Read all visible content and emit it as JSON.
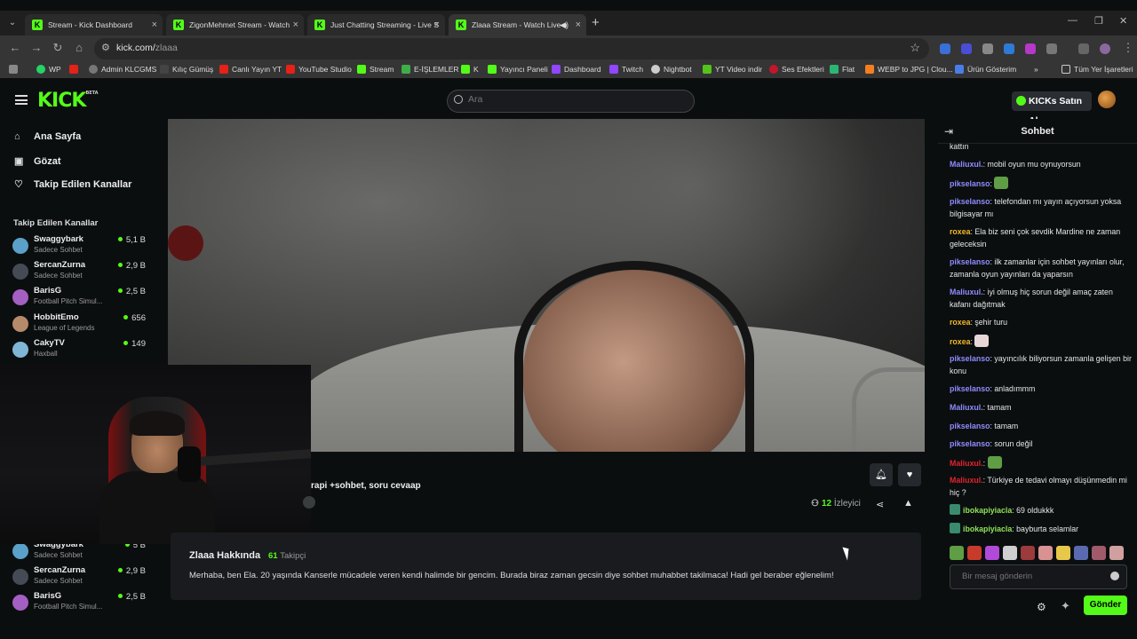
{
  "browser": {
    "tabs": [
      {
        "title": "Stream - Kick Dashboard"
      },
      {
        "title": "ZigonMehmet Stream - Watch"
      },
      {
        "title": "Just Chatting Streaming - Live S"
      },
      {
        "title": "Zlaaa Stream - Watch Live o"
      }
    ],
    "url_host": "kick.com/",
    "url_path": "zlaaa",
    "bookmarks": [
      "WP",
      "",
      "Admin KLCGMS",
      "Kılıç Gümüş",
      "Canlı Yayın YT",
      "YouTube Studio",
      "Stream",
      "E-İŞLEMLER",
      "K",
      "Yayıncı Paneli",
      "Dashboard",
      "Twitch",
      "Nightbot",
      "YT Video indir",
      "Ses Efektleri",
      "Flat",
      "WEBP to JPG | Clou...",
      "Ürün Gösterim",
      "»",
      "Tüm Yer İşaretleri"
    ]
  },
  "header": {
    "logo": "KICK",
    "logo_badge": "BETA",
    "search_placeholder": "Ara",
    "kicks_button": "KICKs Satın Al"
  },
  "sidebar": {
    "links": [
      "Ana Sayfa",
      "Gözat",
      "Takip Edilen Kanallar"
    ],
    "section_title": "Takip Edilen Kanallar",
    "channels": [
      {
        "name": "Swaggybark",
        "category": "Sadece Sohbet",
        "viewers": "5,1 B",
        "color": "#5aa0c8"
      },
      {
        "name": "SercanZurna",
        "category": "Sadece Sohbet",
        "viewers": "2,9 B",
        "color": "#444b55"
      },
      {
        "name": "BarisG",
        "category": "Football Pitch Simul...",
        "viewers": "2,5 B",
        "color": "#a35fc1"
      },
      {
        "name": "HobbitEmo",
        "category": "League of Legends",
        "viewers": "656",
        "color": "#b58a6a"
      },
      {
        "name": "CakyTV",
        "category": "Haxball",
        "viewers": "149",
        "color": "#7fb6d6"
      }
    ],
    "lower_channels": [
      {
        "name": "Swaggybark",
        "category": "Sadece Sohbet",
        "viewers": "5 B",
        "color": "#5aa0c8"
      },
      {
        "name": "SercanZurna",
        "category": "Sadece Sohbet",
        "viewers": "2,9 B",
        "color": "#444b55"
      },
      {
        "name": "BarisG",
        "category": "Football Pitch Simul...",
        "viewers": "2,5 B",
        "color": "#a35fc1"
      }
    ]
  },
  "stream": {
    "title": "rapi +sohbet, soru cevaap",
    "viewers": "12",
    "viewers_label": "İzleyici"
  },
  "about": {
    "name": "Zlaaa Hakkında",
    "followers": "61",
    "followers_label": "Takipçi",
    "bio": "Merhaba, ben Ela. 20 yaşında Kanserle mücadele veren kendi halimde bir gencim. Burada biraz zaman gecsin diye sohbet muhabbet takilmaca! Hadi gel beraber eğlenelim!"
  },
  "chat": {
    "title": "Sohbet",
    "messages": [
      {
        "user": "",
        "text": "kattın",
        "color": "#e6e6e6"
      },
      {
        "user": "Maliuxul.",
        "text": "mobil oyun mu oynuyorsun",
        "color": "#8f8cff"
      },
      {
        "user": "pikselanso",
        "text": "",
        "color": "#8f8cff",
        "emote": "#5f9e44"
      },
      {
        "user": "pikselanso",
        "text": "telefondan mı yayın açıyorsun yoksa bilgisayar mı",
        "color": "#8f8cff"
      },
      {
        "user": "roxea",
        "text": "Ela biz seni çok sevdik Mardine ne zaman geleceksin",
        "color": "#f0b829"
      },
      {
        "user": "pikselanso",
        "text": "ilk zamanlar için sohbet yayınları olur, zamanla oyun yayınları da yaparsın",
        "color": "#8f8cff"
      },
      {
        "user": "Maliuxul.",
        "text": "iyi olmuş hiç sorun değil amaç zaten kafanı dağıtmak",
        "color": "#8f8cff"
      },
      {
        "user": "roxea",
        "text": "şehir turu",
        "color": "#f0b829"
      },
      {
        "user": "roxea",
        "text": "",
        "color": "#f0b829",
        "emote": "#e9d7d7"
      },
      {
        "user": "pikselanso",
        "text": "yayıncılık biliyorsun zamanla gelişen bir konu",
        "color": "#8f8cff"
      },
      {
        "user": "pikselanso",
        "text": "anladımmm",
        "color": "#8f8cff"
      },
      {
        "user": "Maliuxul.",
        "text": "tamam",
        "color": "#8f8cff"
      },
      {
        "user": "pikselanso",
        "text": "tamam",
        "color": "#8f8cff"
      },
      {
        "user": "pikselanso",
        "text": "sorun değil",
        "color": "#8f8cff"
      },
      {
        "user": "Maliuxul.",
        "text": "",
        "color": "#e0242f",
        "emote": "#5f9e44"
      },
      {
        "user": "Maliuxul.",
        "text": "Türkiye de tedavi olmayı düşünmedin mi hiç ?",
        "color": "#e0242f"
      },
      {
        "user": "ibokapiyiacla",
        "text": "69 oldukkk",
        "color": "#8fe35a",
        "badge": true
      },
      {
        "user": "ibokapiyiacla",
        "text": "bayburta selamlar",
        "color": "#8fe35a",
        "badge": true
      }
    ],
    "emote_colors": [
      "#5f9e44",
      "#c83b2b",
      "#b04ad9",
      "#cfcfcf",
      "#9b3b3b",
      "#d99292",
      "#e8c84a",
      "#5a6ab0",
      "#a05a6a",
      "#d0a0a0"
    ],
    "input_placeholder": "Bir mesaj gönderin",
    "send_label": "Gönder"
  }
}
